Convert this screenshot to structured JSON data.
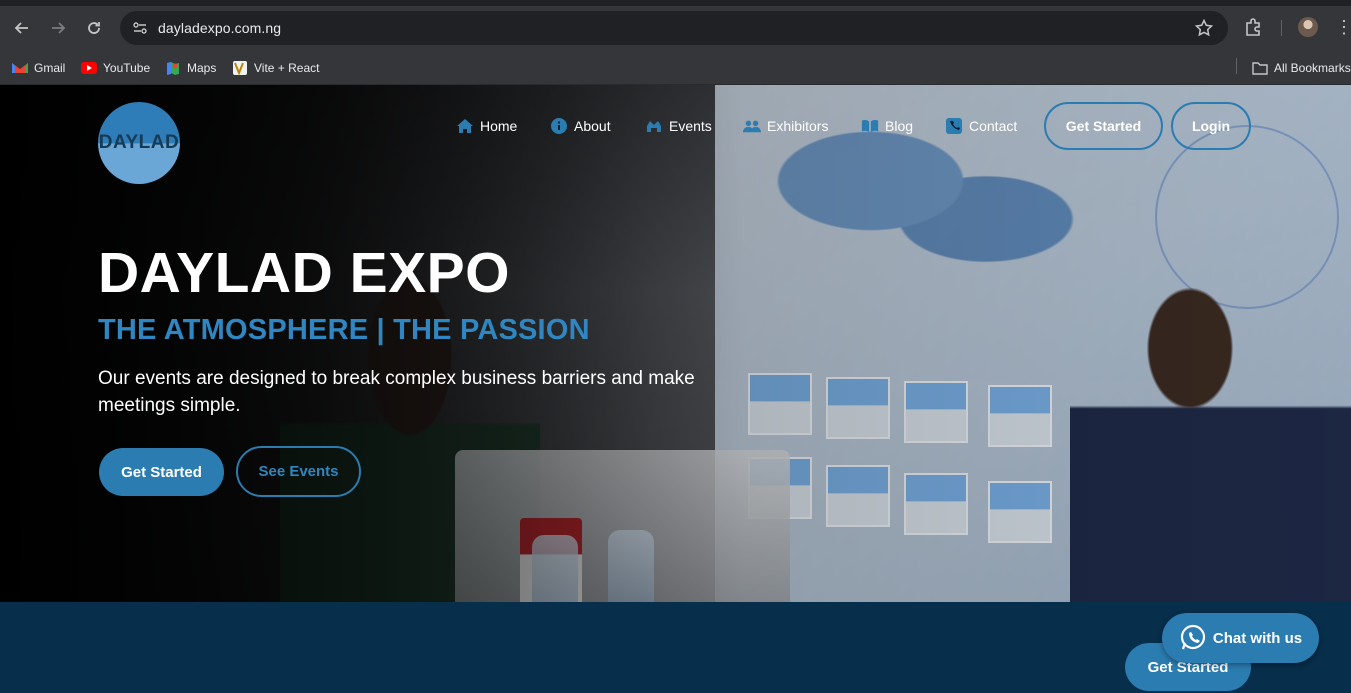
{
  "browser": {
    "url": "dayladexpo.com.ng",
    "bookmarks": [
      {
        "label": "Gmail",
        "icon": "gmail-icon"
      },
      {
        "label": "YouTube",
        "icon": "youtube-icon"
      },
      {
        "label": "Maps",
        "icon": "maps-icon"
      },
      {
        "label": "Vite + React",
        "icon": "vite-icon"
      }
    ],
    "all_bookmarks": "All Bookmarks"
  },
  "site": {
    "logo_text": "DAYLAD",
    "nav": [
      {
        "label": "Home",
        "icon": "home-icon"
      },
      {
        "label": "About",
        "icon": "info-icon"
      },
      {
        "label": "Events",
        "icon": "events-icon"
      },
      {
        "label": "Exhibitors",
        "icon": "users-icon"
      },
      {
        "label": "Blog",
        "icon": "book-icon"
      },
      {
        "label": "Contact",
        "icon": "phone-icon"
      }
    ],
    "get_started_nav": "Get Started",
    "login": "Login"
  },
  "hero": {
    "title": "DAYLAD EXPO",
    "subtitle": "THE ATMOSPHERE | THE PASSION",
    "description": "Our events are designed to break complex business barriers and make meetings simple.",
    "primary_button": "Get Started",
    "secondary_button": "See Events"
  },
  "band": {
    "get_started": "Get Started",
    "chat": "Chat with us"
  },
  "colors": {
    "accent": "#2b7cb0",
    "subtitle": "#2f86c1",
    "band": "#072e4b"
  }
}
